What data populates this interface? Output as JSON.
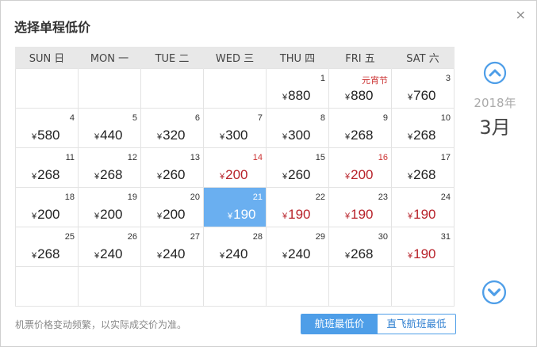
{
  "dialog": {
    "title": "选择单程低价",
    "close_label": "×"
  },
  "weekdays": [
    "SUN 日",
    "MON 一",
    "TUE 二",
    "WED 三",
    "THU 四",
    "FRI 五",
    "SAT 六"
  ],
  "currency": "¥",
  "weeks": [
    [
      null,
      null,
      null,
      null,
      {
        "day": "1",
        "price": "880"
      },
      {
        "day": "元宵节",
        "price": "880",
        "day_red": true
      },
      {
        "day": "3",
        "price": "760"
      }
    ],
    [
      {
        "day": "4",
        "price": "580"
      },
      {
        "day": "5",
        "price": "440"
      },
      {
        "day": "6",
        "price": "320"
      },
      {
        "day": "7",
        "price": "300"
      },
      {
        "day": "8",
        "price": "300"
      },
      {
        "day": "9",
        "price": "268"
      },
      {
        "day": "10",
        "price": "268"
      }
    ],
    [
      {
        "day": "11",
        "price": "268"
      },
      {
        "day": "12",
        "price": "268"
      },
      {
        "day": "13",
        "price": "260"
      },
      {
        "day": "14",
        "price": "200",
        "day_red": true,
        "price_red": true
      },
      {
        "day": "15",
        "price": "260"
      },
      {
        "day": "16",
        "price": "200",
        "day_red": true,
        "price_red": true
      },
      {
        "day": "17",
        "price": "268"
      }
    ],
    [
      {
        "day": "18",
        "price": "200"
      },
      {
        "day": "19",
        "price": "200"
      },
      {
        "day": "20",
        "price": "200"
      },
      {
        "day": "21",
        "price": "190",
        "selected": true
      },
      {
        "day": "22",
        "price": "190",
        "price_red": true
      },
      {
        "day": "23",
        "price": "190",
        "price_red": true
      },
      {
        "day": "24",
        "price": "190",
        "price_red": true
      }
    ],
    [
      {
        "day": "25",
        "price": "268"
      },
      {
        "day": "26",
        "price": "240"
      },
      {
        "day": "27",
        "price": "240"
      },
      {
        "day": "28",
        "price": "240"
      },
      {
        "day": "29",
        "price": "240"
      },
      {
        "day": "30",
        "price": "268"
      },
      {
        "day": "31",
        "price": "190",
        "price_red": true
      }
    ],
    [
      null,
      null,
      null,
      null,
      null,
      null,
      null
    ]
  ],
  "side": {
    "year": "2018年",
    "month": "3月"
  },
  "footer": {
    "note": "机票价格变动频繁，以实际成交价为准。",
    "toggle_active": "航班最低价",
    "toggle_inactive": "直飞航班最低价"
  },
  "colors": {
    "accent": "#4e9ee8",
    "selected_cell": "#6aaff0",
    "low_price": "#b8222a"
  },
  "icons": {
    "prev": "chevron-up-circle-icon",
    "next": "chevron-down-circle-icon",
    "close": "close-icon"
  }
}
